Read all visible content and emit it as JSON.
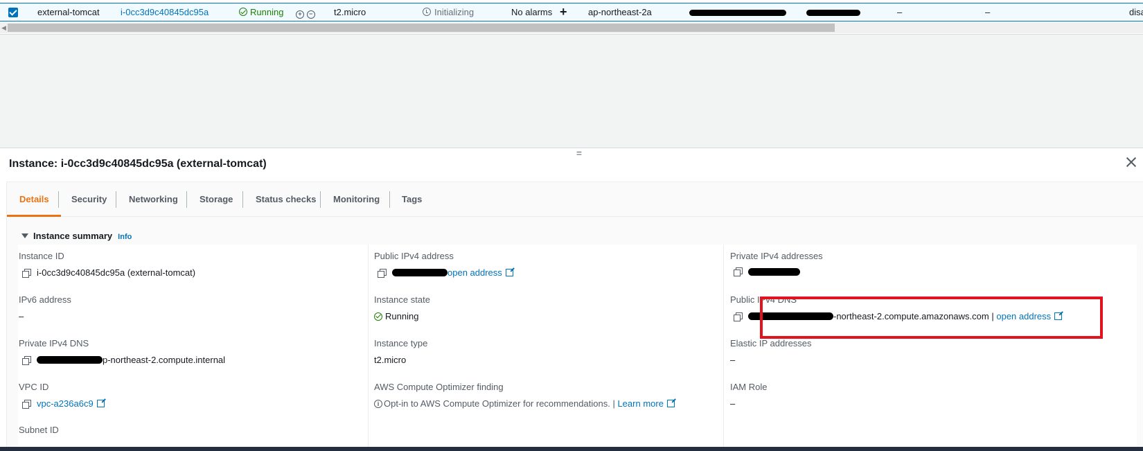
{
  "instance_row": {
    "name": "external-tomcat",
    "instance_id": "i-0cc3d9c40845dc95a",
    "state": "Running",
    "type": "t2.micro",
    "status_check": "Initializing",
    "alarm_status": "No alarms",
    "add_alarm": "+",
    "az": "ap-northeast-2a",
    "col_elastic_ip": "–",
    "col_ipv6": "–",
    "col_trailing": "disa",
    "zoom_in": "+",
    "zoom_out": "−"
  },
  "panel": {
    "resize_handle": "=",
    "title": "Instance: i-0cc3d9c40845dc95a (external-tomcat)",
    "tabs": [
      "Details",
      "Security",
      "Networking",
      "Storage",
      "Status checks",
      "Monitoring",
      "Tags"
    ],
    "active_tab": "Details",
    "summary": {
      "heading": "Instance summary",
      "info_link": "Info"
    },
    "fields": {
      "instance_id": {
        "label": "Instance ID",
        "value": "i-0cc3d9c40845dc95a (external-tomcat)"
      },
      "public_ipv4": {
        "label": "Public IPv4 address",
        "link": "open address"
      },
      "private_ipv4": {
        "label": "Private IPv4 addresses"
      },
      "ipv6": {
        "label": "IPv6 address",
        "value": "–"
      },
      "instance_state": {
        "label": "Instance state",
        "value": "Running"
      },
      "public_dns": {
        "label": "Public IPv4 DNS",
        "value_suffix": "-northeast-2.compute.amazonaws.com",
        "separator": "|",
        "link": "open address"
      },
      "private_dns": {
        "label": "Private IPv4 DNS",
        "value_suffix": "p-northeast-2.compute.internal"
      },
      "instance_type": {
        "label": "Instance type",
        "value": "t2.micro"
      },
      "elastic_ip": {
        "label": "Elastic IP addresses",
        "value": "–"
      },
      "vpc_id": {
        "label": "VPC ID",
        "value": "vpc-a236a6c9"
      },
      "optimizer": {
        "label": "AWS Compute Optimizer finding",
        "info_glyph": "i",
        "text": "Opt-in to AWS Compute Optimizer for recommendations.",
        "separator": "|",
        "link": "Learn more"
      },
      "iam_role": {
        "label": "IAM Role",
        "value": "–"
      },
      "subnet_id": {
        "label": "Subnet ID"
      }
    }
  },
  "colors": {
    "link": "#0073bb",
    "success": "#1d8102",
    "active_tab": "#ec7211",
    "highlight": "#e0131f",
    "redaction": "#000000"
  }
}
